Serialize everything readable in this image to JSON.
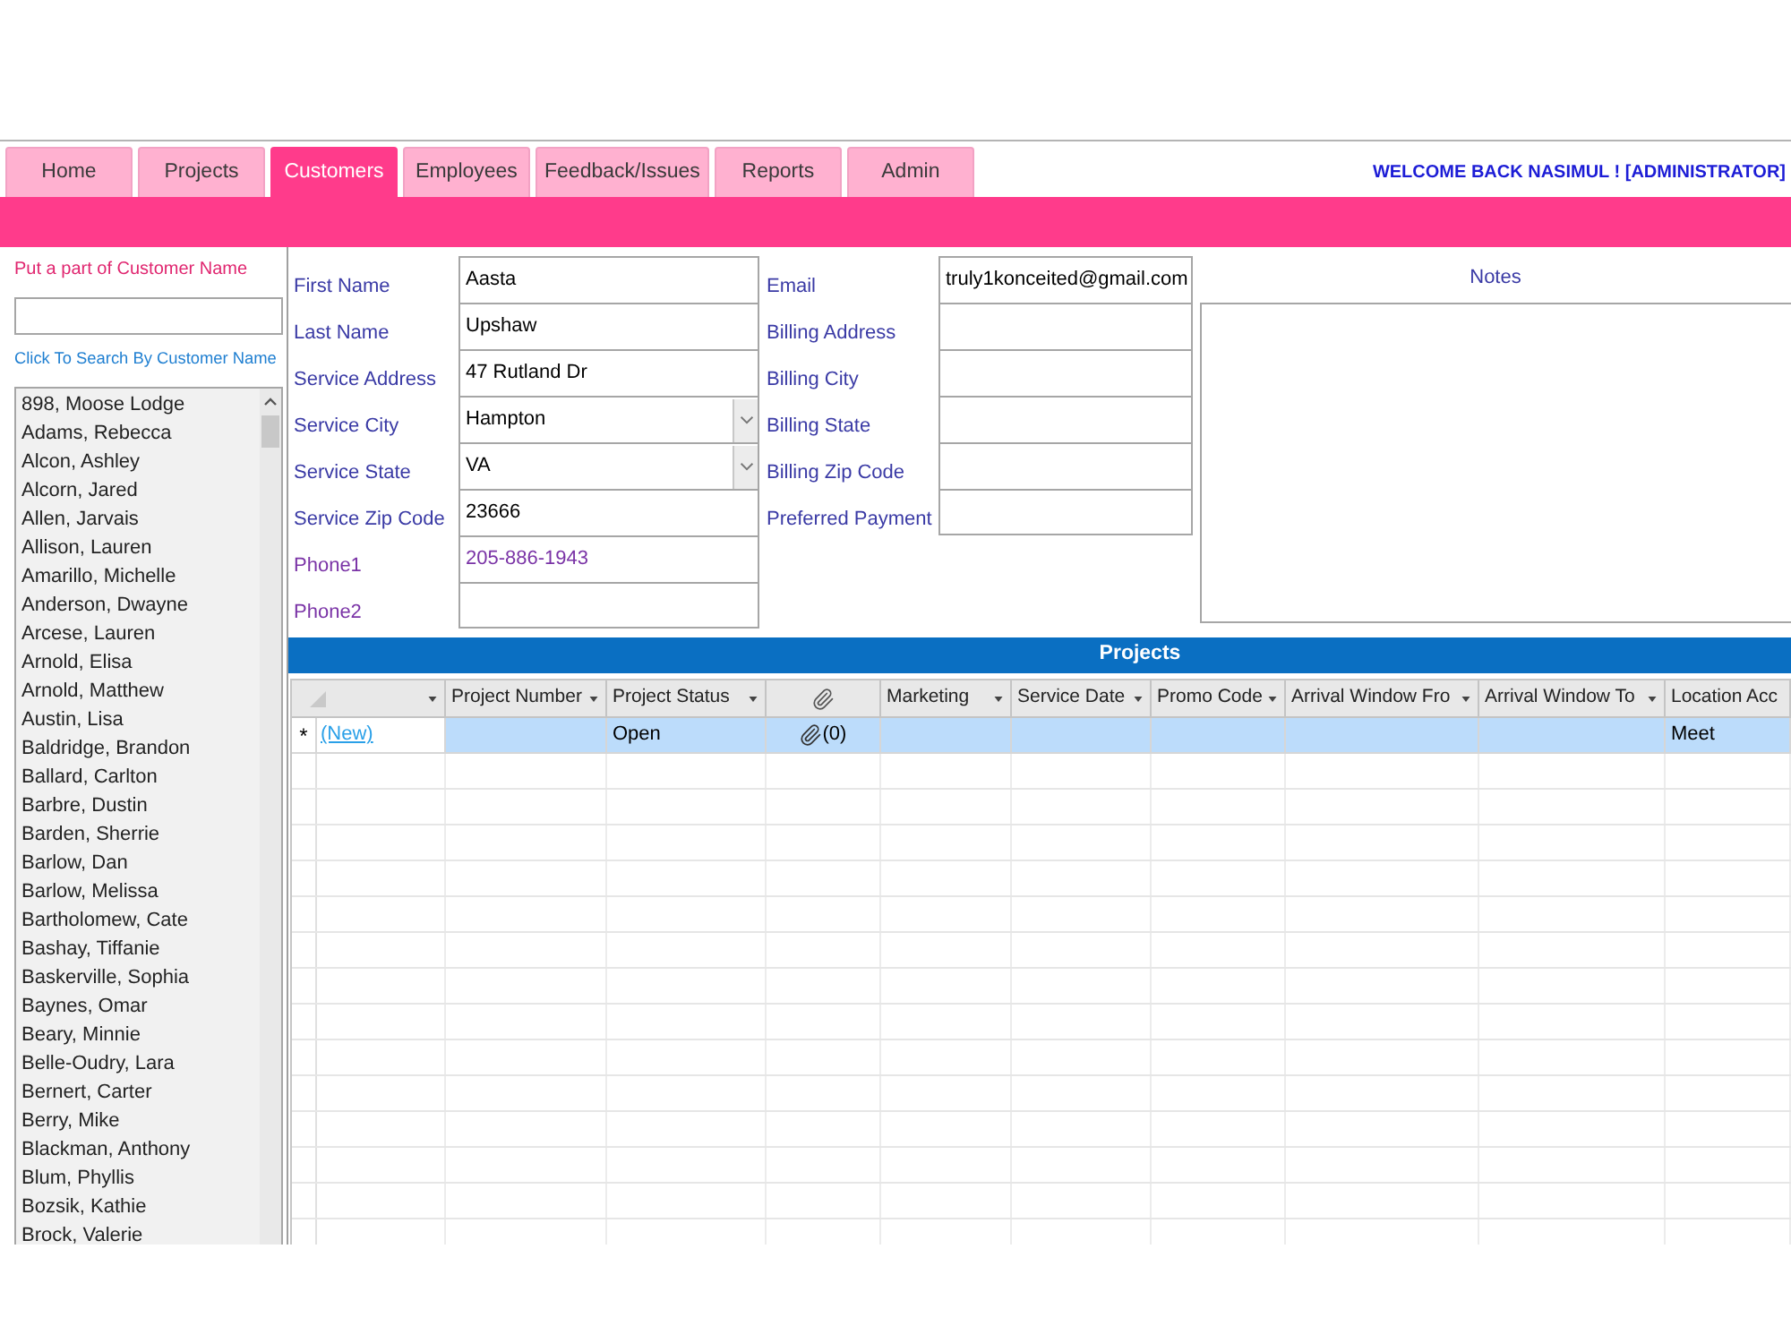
{
  "tabs": [
    {
      "label": "Home",
      "selected": false
    },
    {
      "label": "Projects",
      "selected": false
    },
    {
      "label": "Customers",
      "selected": true
    },
    {
      "label": "Employees",
      "selected": false
    },
    {
      "label": "Feedback/Issues",
      "selected": false
    },
    {
      "label": "Reports",
      "selected": false
    },
    {
      "label": "Admin",
      "selected": false
    }
  ],
  "welcome": "WELCOME BACK NASIMUL ! [ADMINISTRATOR]",
  "sidebar": {
    "search_label": "Put a part of Customer Name",
    "search_link": "Click To Search By Customer Name",
    "customers": [
      {
        "name": "898, Moose Lodge",
        "selected": false
      },
      {
        "name": "Adams, Rebecca",
        "selected": false
      },
      {
        "name": "Alcon, Ashley",
        "selected": false
      },
      {
        "name": "Alcorn, Jared",
        "selected": false
      },
      {
        "name": "Allen, Jarvais",
        "selected": false
      },
      {
        "name": "Allison, Lauren",
        "selected": false
      },
      {
        "name": "Amarillo, Michelle",
        "selected": false
      },
      {
        "name": "Anderson, Dwayne",
        "selected": false
      },
      {
        "name": "Arcese, Lauren",
        "selected": false
      },
      {
        "name": "Arnold, Elisa",
        "selected": false
      },
      {
        "name": "Arnold, Matthew",
        "selected": false
      },
      {
        "name": "Austin, Lisa",
        "selected": false
      },
      {
        "name": "Baldridge, Brandon",
        "selected": false
      },
      {
        "name": "Ballard, Carlton",
        "selected": false
      },
      {
        "name": "Barbre, Dustin",
        "selected": false
      },
      {
        "name": "Barden, Sherrie",
        "selected": false
      },
      {
        "name": "Barlow, Dan",
        "selected": false
      },
      {
        "name": "Barlow, Melissa",
        "selected": false
      },
      {
        "name": "Bartholomew, Cate",
        "selected": false
      },
      {
        "name": "Bashay, Tiffanie",
        "selected": false
      },
      {
        "name": "Baskerville, Sophia",
        "selected": false
      },
      {
        "name": "Baynes, Omar",
        "selected": false
      },
      {
        "name": "Beary, Minnie",
        "selected": false
      },
      {
        "name": "Belle-Oudry, Lara",
        "selected": false
      },
      {
        "name": "Bernert, Carter",
        "selected": false
      },
      {
        "name": "Berry, Mike",
        "selected": false
      },
      {
        "name": "Blackman, Anthony",
        "selected": false
      },
      {
        "name": "Blum, Phyllis",
        "selected": false
      },
      {
        "name": "Bozsik, Kathie",
        "selected": false
      },
      {
        "name": "Brock, Valerie",
        "selected": false
      }
    ]
  },
  "customer_form": {
    "left_fields": [
      {
        "label": "First Name",
        "value": "Aasta",
        "kind": "text"
      },
      {
        "label": "Last Name",
        "value": "Upshaw",
        "kind": "text"
      },
      {
        "label": "Service Address",
        "value": "47 Rutland Dr",
        "kind": "text"
      },
      {
        "label": "Service City",
        "value": "Hampton",
        "kind": "dropdown"
      },
      {
        "label": "Service State",
        "value": "VA",
        "kind": "dropdown"
      },
      {
        "label": "Service Zip Code",
        "value": "23666",
        "kind": "text"
      },
      {
        "label": "Phone1",
        "value": "205-886-1943",
        "kind": "phone"
      },
      {
        "label": "Phone2",
        "kind": "phone"
      }
    ],
    "right_fields": [
      {
        "label": "Email",
        "value": "truly1konceited@gmail.com"
      },
      {
        "label": "Billing Address"
      },
      {
        "label": "Billing City"
      },
      {
        "label": "Billing State"
      },
      {
        "label": "Billing Zip Code"
      },
      {
        "label": "Preferred Payment"
      }
    ],
    "notes": {
      "label": "Notes"
    }
  },
  "projects": {
    "title": "Projects",
    "columns": [
      {
        "kind": "selector",
        "filter": true
      },
      {
        "kind": "text",
        "label": "Project Number",
        "filter": true
      },
      {
        "kind": "text",
        "label": "Project Status",
        "filter": true
      },
      {
        "kind": "attachment",
        "filter": false
      },
      {
        "kind": "text",
        "label": "Marketing",
        "filter": true
      },
      {
        "kind": "text",
        "label": "Service Date",
        "filter": true
      },
      {
        "kind": "text",
        "label": "Promo Code",
        "filter": true
      },
      {
        "kind": "text",
        "label": "Arrival Window Fro",
        "filter": true
      },
      {
        "kind": "text",
        "label": "Arrival Window To",
        "filter": true
      },
      {
        "kind": "text",
        "label": "Location Acc",
        "filter": false
      }
    ],
    "rows": [
      {
        "marker": "*",
        "selected": true,
        "cells": [
          {
            "kind": "link",
            "text": "(New)"
          },
          {
            "kind": "empty"
          },
          {
            "kind": "text",
            "text": "Open"
          },
          {
            "kind": "attachment",
            "text": "(0)"
          },
          {
            "kind": "empty"
          },
          {
            "kind": "empty"
          },
          {
            "kind": "empty"
          },
          {
            "kind": "empty"
          },
          {
            "kind": "empty"
          },
          {
            "kind": "text",
            "text": "Meet"
          }
        ]
      }
    ]
  }
}
